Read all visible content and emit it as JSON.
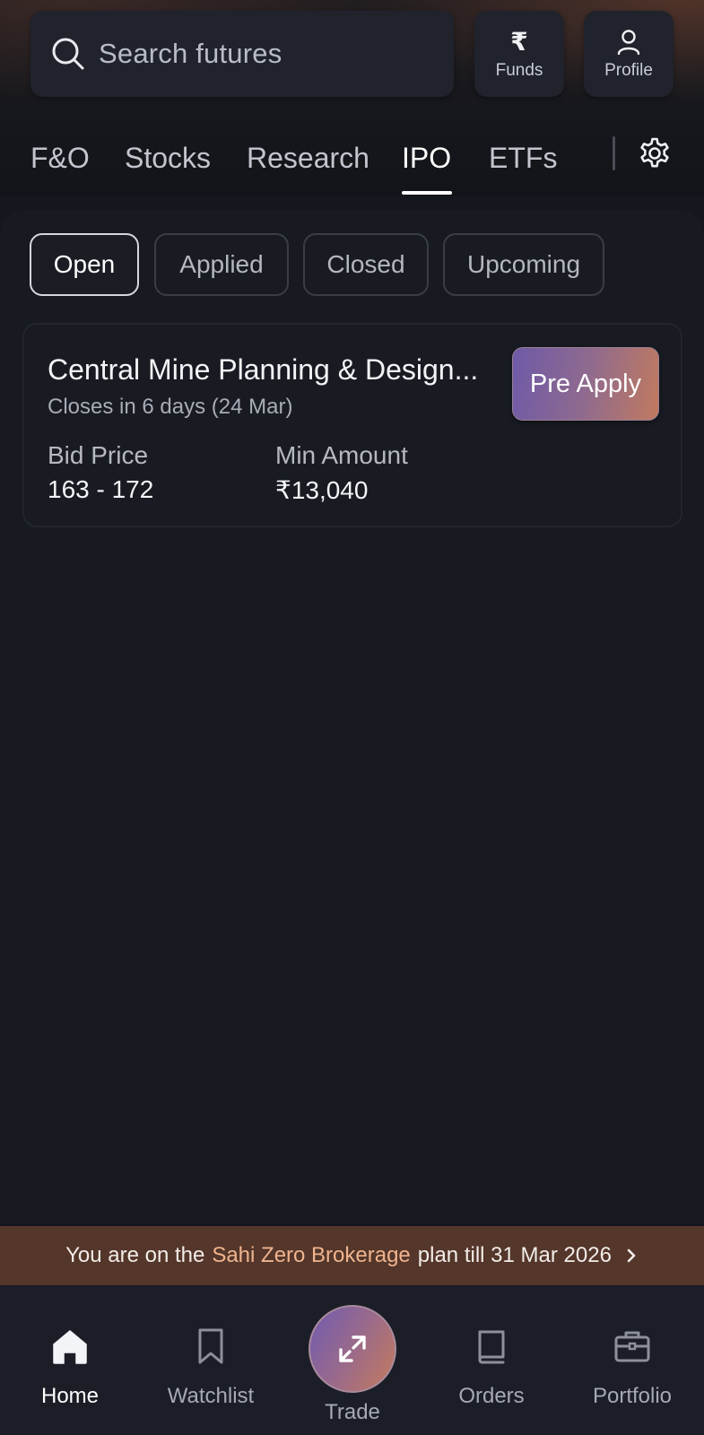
{
  "search": {
    "placeholder": "Search futures"
  },
  "header": {
    "funds_label": "Funds",
    "funds_icon": "rupee-icon",
    "profile_label": "Profile",
    "profile_icon": "user-icon"
  },
  "tabs": [
    {
      "label": "F&O",
      "active": false
    },
    {
      "label": "Stocks",
      "active": false
    },
    {
      "label": "Research",
      "active": false
    },
    {
      "label": "IPO",
      "active": true
    },
    {
      "label": "ETFs",
      "active": false
    }
  ],
  "filters": [
    {
      "label": "Open",
      "active": true
    },
    {
      "label": "Applied",
      "active": false
    },
    {
      "label": "Closed",
      "active": false
    },
    {
      "label": "Upcoming",
      "active": false
    }
  ],
  "ipo_list": [
    {
      "name": "Central Mine Planning & Design...",
      "closes": "Closes in 6 days (24 Mar)",
      "action_label": "Pre Apply",
      "bid_price_label": "Bid Price",
      "bid_price_value": "163 - 172",
      "min_amount_label": "Min Amount",
      "min_amount_value": "₹13,040"
    }
  ],
  "banner": {
    "prefix": "You are on the",
    "highlight": "Sahi Zero Brokerage",
    "suffix": "plan till 31 Mar 2026"
  },
  "bottom_nav": [
    {
      "label": "Home",
      "icon": "home-icon",
      "active": true
    },
    {
      "label": "Watchlist",
      "icon": "bookmark-icon",
      "active": false
    },
    {
      "label": "Trade",
      "icon": "trade-arrows-icon",
      "active": false
    },
    {
      "label": "Orders",
      "icon": "book-icon",
      "active": false
    },
    {
      "label": "Portfolio",
      "icon": "briefcase-icon",
      "active": false
    }
  ],
  "colors": {
    "background": "#14171e",
    "accent_gradient_start": "#6e5aa8",
    "accent_gradient_end": "#c17a5f",
    "banner_bg": "#54362a",
    "banner_highlight": "#f0b48f"
  }
}
